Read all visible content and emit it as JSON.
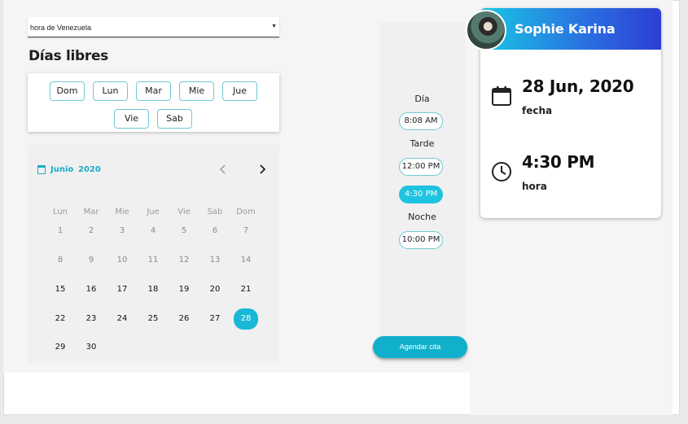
{
  "timezone": {
    "value": "hora de Venezuela"
  },
  "free_days": {
    "title": "Días libres",
    "days": [
      "Dom",
      "Lun",
      "Mar",
      "Mie",
      "Jue",
      "Vie",
      "Sab"
    ]
  },
  "calendar": {
    "month": "Junio",
    "year": "2020",
    "weekdays": [
      "Lun",
      "Mar",
      "Mie",
      "Jue",
      "Vie",
      "Sab",
      "Dom"
    ],
    "days": [
      "1",
      "2",
      "3",
      "4",
      "5",
      "6",
      "7",
      "8",
      "9",
      "10",
      "11",
      "12",
      "13",
      "14",
      "15",
      "16",
      "17",
      "18",
      "19",
      "20",
      "21",
      "22",
      "23",
      "24",
      "25",
      "26",
      "27",
      "28",
      "29",
      "30"
    ],
    "selected": "28"
  },
  "times": {
    "periods": [
      {
        "label": "Día",
        "slots": [
          "8:08 AM"
        ]
      },
      {
        "label": "Tarde",
        "slots": [
          "12:00 PM",
          "4:30 PM"
        ]
      },
      {
        "label": "Noche",
        "slots": [
          "10:00 PM"
        ]
      }
    ],
    "selected": "4:30 PM"
  },
  "action": {
    "label": "Agendar cita"
  },
  "summary": {
    "name": "Sophie Karina",
    "date_value": "28 Jun, 2020",
    "date_label": "fecha",
    "time_value": "4:30 PM",
    "time_label": "hora"
  },
  "colors": {
    "accent": "#18b8d6",
    "chip_border": "#6fc8d6"
  },
  "icons": [
    "calendar-icon",
    "chevron-left-icon",
    "chevron-right-icon",
    "event-icon",
    "clock-icon",
    "dropdown-arrow-icon"
  ]
}
